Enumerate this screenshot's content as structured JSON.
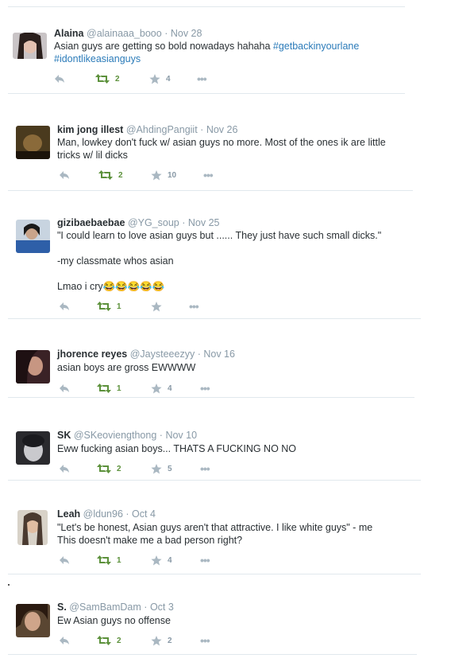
{
  "tweets": [
    {
      "name": "Alaina",
      "handle": "@alainaaa_booo",
      "date": "Nov 28",
      "lines": [
        "Asian guys are getting so bold nowadays hahaha "
      ],
      "tags": [
        "#getbackinyourlane",
        "#idontlikeasianguys"
      ],
      "retweets": "2",
      "favorites": "4"
    },
    {
      "name": "kim jong illest",
      "handle": "@AhdingPangiit",
      "date": "Nov 26",
      "lines": [
        "Man, lowkey don't fuck w/ asian guys no more. Most of the ones ik are little",
        "tricks w/ lil dicks"
      ],
      "retweets": "2",
      "favorites": "10"
    },
    {
      "name": "gizibaebaebae",
      "handle": "@YG_soup",
      "date": "Nov 25",
      "lines": [
        "\"I could learn to love asian guys but ...... They just have such small dicks.\"",
        "-my classmate whos asian",
        "Lmao i cry😂😂😂😂😂"
      ],
      "retweets": "1",
      "favorites": ""
    },
    {
      "name": "jhorence reyes",
      "handle": "@Jaysteeezyy",
      "date": "Nov 16",
      "lines": [
        "asian boys are gross EWWWW"
      ],
      "retweets": "1",
      "favorites": "4"
    },
    {
      "name": "SK",
      "handle": "@SKeoviengthong",
      "date": "Nov 10",
      "lines": [
        "Eww fucking asian boys... THATS A FUCKING NO NO"
      ],
      "retweets": "2",
      "favorites": "5"
    },
    {
      "name": "Leah",
      "handle": "@ldun96",
      "date": "Oct 4",
      "lines": [
        "\"Let's be honest, Asian guys aren't that attractive. I like white guys\" - me",
        "This doesn't make me a bad person right?"
      ],
      "retweets": "1",
      "favorites": "4"
    },
    {
      "name": "S.",
      "handle": "@SamBamDam",
      "date": "Oct 3",
      "lines": [
        "Ew Asian guys no offense"
      ],
      "retweets": "2",
      "favorites": "2"
    }
  ],
  "separator": "·",
  "more_glyph": "•••",
  "colors": {
    "name": "#292f33",
    "meta": "#8899a6",
    "hashtag": "#2b7bb9",
    "retweet": "#5c913b",
    "icon_gray": "#aab8c2",
    "divider": "#e1e8ed"
  },
  "icons": {
    "reply": "reply-icon",
    "retweet": "retweet-icon",
    "favorite": "star-icon",
    "more": "more-icon"
  }
}
